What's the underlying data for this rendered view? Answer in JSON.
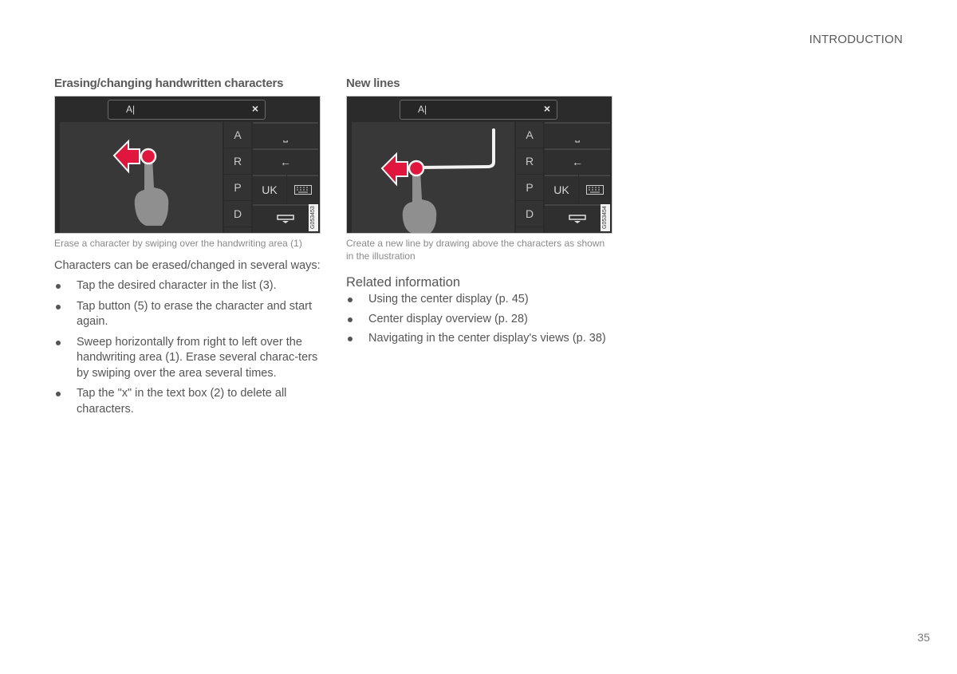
{
  "header": {
    "section": "INTRODUCTION"
  },
  "footer": {
    "page_number": "35"
  },
  "left_column": {
    "heading": "Erasing/changing handwritten characters",
    "figure": {
      "textbox_value": "A|",
      "clear_glyph": "×",
      "char_list": [
        "A",
        "R",
        "P",
        "D"
      ],
      "keys": {
        "space": "⎵",
        "backspace": "←",
        "language": "UK"
      },
      "figure_code": "G053453",
      "accent_color": "#e0163e"
    },
    "caption": "Erase a character by swiping over the handwriting area (1)",
    "intro": "Characters can be erased/changed in several ways:",
    "bullets": [
      "Tap the desired character in the list (3).",
      "Tap button (5) to erase the character and start again.",
      "Sweep horizontally from right to left over the handwriting area (1). Erase several charac-ters by swiping over the area several times.",
      "Tap the \"x\" in the text box (2) to delete all characters."
    ]
  },
  "right_column": {
    "heading": "New lines",
    "figure": {
      "textbox_value": "A|",
      "clear_glyph": "×",
      "char_list": [
        "A",
        "R",
        "P",
        "D"
      ],
      "keys": {
        "space": "⎵",
        "backspace": "←",
        "language": "UK"
      },
      "figure_code": "G053454",
      "accent_color": "#e0163e"
    },
    "caption": "Create a new line by drawing above the characters as shown in the illustration",
    "related_heading": "Related information",
    "related_links": [
      "Using the center display (p. 45)",
      "Center display overview (p. 28)",
      "Navigating in the center display's views (p. 38)"
    ]
  }
}
